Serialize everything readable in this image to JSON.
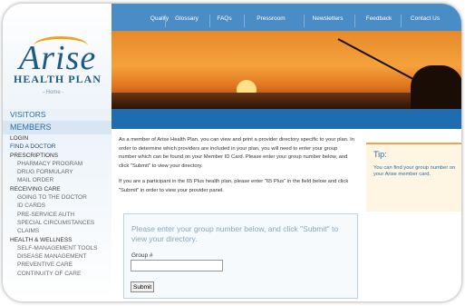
{
  "brand": {
    "name": "Arise",
    "sub": "HEALTH PLAN",
    "home": "- Home -"
  },
  "topnav": [
    "Quality",
    "Glossary",
    "FAQs",
    "Pressroom",
    "Newsletters",
    "Feedback",
    "Contact Us"
  ],
  "sidenav": {
    "visitors": "VISITORS",
    "members": "MEMBERS",
    "items": [
      {
        "label": "LOGIN",
        "type": "item"
      },
      {
        "label": "FIND A DOCTOR",
        "type": "item hl"
      },
      {
        "label": "PRESCRIPTIONS",
        "type": "item"
      },
      {
        "label": "PHARMACY PROGRAM",
        "type": "sub"
      },
      {
        "label": "DRUG FORMULARY",
        "type": "sub"
      },
      {
        "label": "MAIL ORDER",
        "type": "sub"
      },
      {
        "label": "RECEIVING CARE",
        "type": "item"
      },
      {
        "label": "GOING TO THE DOCTOR",
        "type": "sub"
      },
      {
        "label": "ID CARDS",
        "type": "sub"
      },
      {
        "label": "PRE-SERVICE AUTH",
        "type": "sub"
      },
      {
        "label": "SPECIAL CIRCUMSTANCES",
        "type": "sub"
      },
      {
        "label": "CLAIMS",
        "type": "sub"
      },
      {
        "label": "HEALTH & WELLNESS",
        "type": "item"
      },
      {
        "label": "SELF-MANAGEMENT TOOLS",
        "type": "sub"
      },
      {
        "label": "DISEASE MANAGEMENT",
        "type": "sub"
      },
      {
        "label": "PREVENTIVE CARE",
        "type": "sub"
      },
      {
        "label": "CONTINUITY OF CARE",
        "type": "sub"
      }
    ]
  },
  "main": {
    "para1": "As a member of Arise Health Plan, you can view and print a provider directory specific to your plan. In order to determine which providers are included in your plan, you will need to enter your group number which can be found on your Member ID Card. Please enter your group number below, and click \"Submit\" to view your directory.",
    "para2": "If you are a participant in the 65 Plus health plan, please enter \"65 Plus\" in the field below and click \"Submit\" in order to view your provider panel.",
    "form": {
      "heading": "Please enter your group number below, and click \"Submit\" to view your directory.",
      "label": "Group #",
      "value": "",
      "submit": "Submit"
    }
  },
  "tip": {
    "title": "Tip:",
    "body": "You can find your group number on your Arise member card."
  },
  "colors": {
    "accent": "#4a8cc5",
    "band": "#1f6cb0",
    "brand": "#1d5b86",
    "tip_bg": "#fff5e3"
  }
}
